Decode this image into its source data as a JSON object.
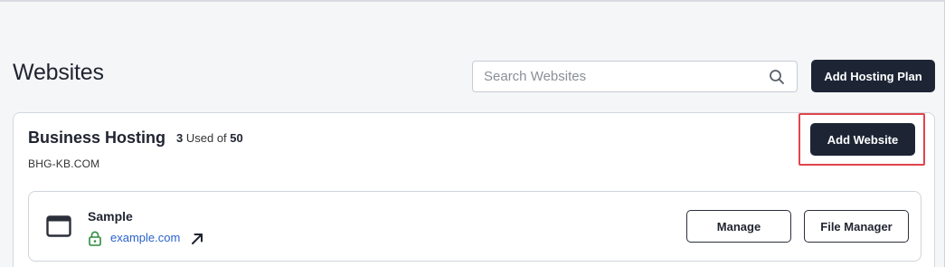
{
  "header": {
    "title": "Websites",
    "search_placeholder": "Search Websites",
    "add_plan_label": "Add Hosting Plan"
  },
  "plan": {
    "name": "Business Hosting",
    "used": "3",
    "used_text": "Used of",
    "total": "50",
    "domain": "BHG-KB.COM",
    "add_website_label": "Add Website"
  },
  "sites": [
    {
      "name": "Sample",
      "url": "example.com",
      "manage_label": "Manage",
      "file_manager_label": "File Manager"
    }
  ],
  "colors": {
    "primary_button": "#1d2535",
    "link": "#2a63c9",
    "secure_lock": "#2e8b3e",
    "highlight": "#e0454b"
  },
  "icons": [
    "search-icon",
    "browser-window-icon",
    "lock-icon",
    "external-link-icon"
  ]
}
